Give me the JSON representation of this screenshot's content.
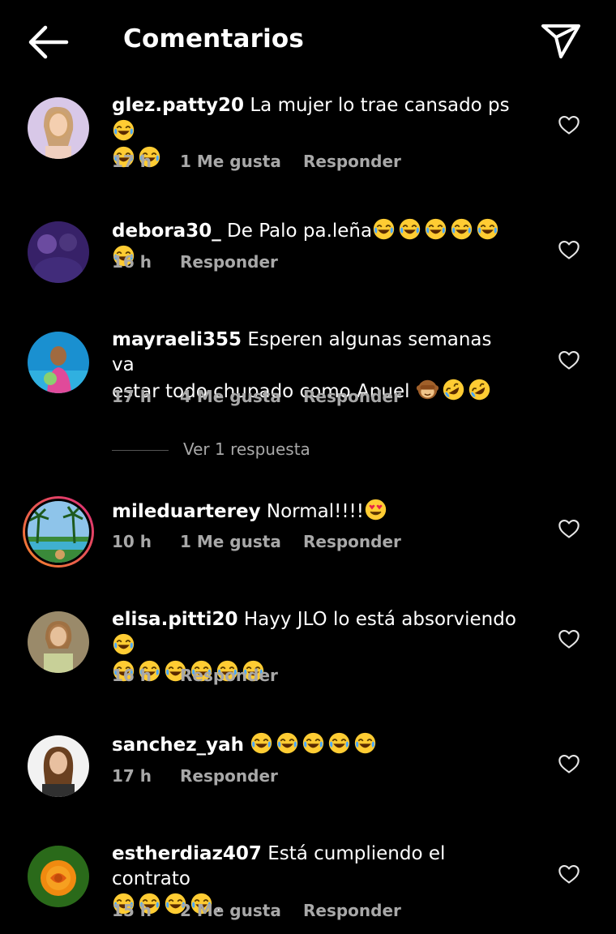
{
  "header": {
    "title": "Comentarios",
    "back_icon": "back-arrow-icon",
    "send_icon": "paper-plane-icon"
  },
  "colors": {
    "background": "#000000",
    "text": "#ffffff",
    "meta": "#a8a8a8",
    "story_ring_start": "#f58529",
    "story_ring_end": "#dd2a7b"
  },
  "labels": {
    "reply": "Responder",
    "view_replies": "Ver 1 respuesta"
  },
  "comments": [
    {
      "user": "glez.patty20",
      "text": "La mujer lo trae cansado ps",
      "emojis_inline": "😂",
      "emojis_line2": "😂😂",
      "time": "17 h",
      "likes": "1 Me gusta"
    },
    {
      "user": "debora30_",
      "text": "De Palo pa.leña",
      "emojis_inline": "😂😂😂😂😂😂",
      "time": "16 h"
    },
    {
      "user": "mayraeli355",
      "text": "Esperen algunas semanas va",
      "text2": "estar todo chupado como Anuel",
      "emojis_line2": "🙈🤣🤣",
      "time": "17 h",
      "likes": "4 Me gusta"
    },
    {
      "user": "mileduarterey",
      "text": "Normal!!!!",
      "emojis_inline": "😍",
      "time": "10 h",
      "likes": "1 Me gusta"
    },
    {
      "user": "elisa.pitti20",
      "text": "Hayy JLO lo está absorviendo",
      "emojis_inline": "😂",
      "emojis_line2": "😂😂😂😂😂😂",
      "time": "16 h"
    },
    {
      "user": "sanchez_yah",
      "text": "",
      "emojis_inline": "😂😂😂😂😂",
      "time": "17 h"
    },
    {
      "user": "estherdiaz407",
      "text": "Está cumpliendo el contrato",
      "emojis_line2": "😂😂😂😂",
      "line2_suffix": ".",
      "time": "15 h",
      "likes": "2 Me gusta"
    }
  ]
}
